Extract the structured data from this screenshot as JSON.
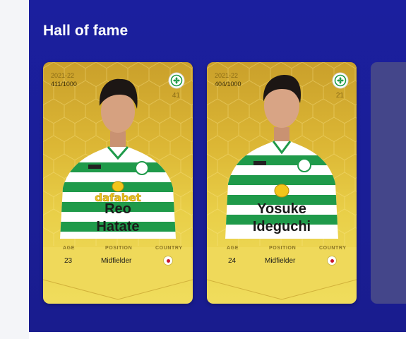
{
  "section": {
    "title": "Hall of fame"
  },
  "cards": [
    {
      "season": "2021-22",
      "serial": "411/1000",
      "jersey_number": "41",
      "first_name": "Reo",
      "last_name": "Hatate",
      "age_label": "AGE",
      "age": "23",
      "position_label": "POSITION",
      "position": "Midfielder",
      "country_label": "COUNTRY",
      "country_flag": "japan-flag",
      "sponsor": "dafabet"
    },
    {
      "season": "2021-22",
      "serial": "404/1000",
      "jersey_number": "21",
      "first_name": "Yosuke",
      "last_name": "Ideguchi",
      "age_label": "AGE",
      "age": "24",
      "position_label": "POSITION",
      "position": "Midfielder",
      "country_label": "COUNTRY",
      "country_flag": "japan-flag"
    }
  ],
  "colors": {
    "panel_bg": "#1b1f9e",
    "card_gold": "#e9cf48",
    "celtic_green": "#1f9a4a",
    "peek_card": "#44468a"
  }
}
